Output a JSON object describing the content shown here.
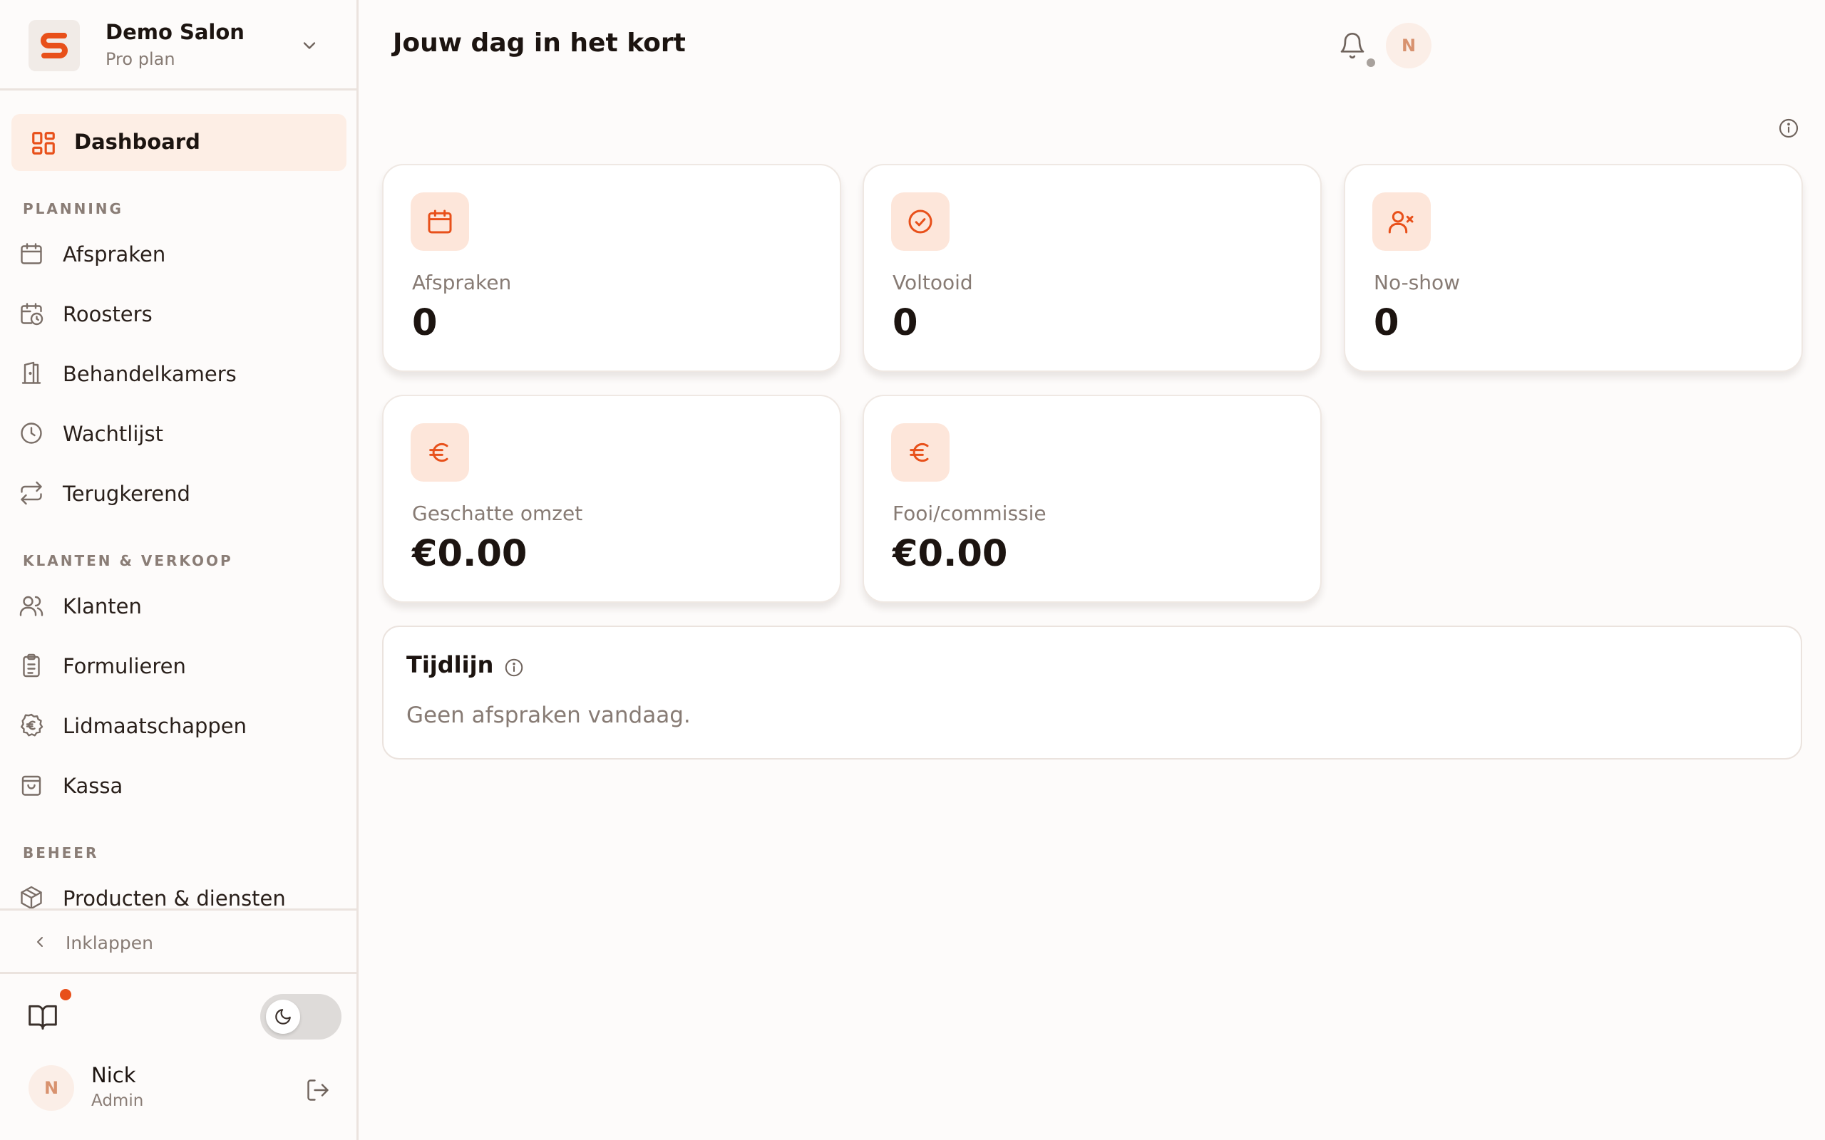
{
  "brand": {
    "name": "Demo Salon",
    "plan": "Pro plan"
  },
  "nav": {
    "active_label": "Dashboard",
    "sections": [
      {
        "label": "PLANNING",
        "items": [
          "Afspraken",
          "Roosters",
          "Behandelkamers",
          "Wachtlijst",
          "Terugkerend"
        ]
      },
      {
        "label": "KLANTEN & VERKOOP",
        "items": [
          "Klanten",
          "Formulieren",
          "Lidmaatschappen",
          "Kassa"
        ]
      },
      {
        "label": "BEHEER",
        "items": [
          "Producten & diensten"
        ]
      }
    ],
    "collapse_label": "Inklappen"
  },
  "user": {
    "initial": "N",
    "name": "Nick",
    "role": "Admin"
  },
  "header": {
    "title": "Jouw dag in het kort",
    "avatar_initial": "N"
  },
  "stats": [
    {
      "label": "Afspraken",
      "value": "0",
      "icon": "calendar-icon"
    },
    {
      "label": "Voltooid",
      "value": "0",
      "icon": "check-circle-icon"
    },
    {
      "label": "No-show",
      "value": "0",
      "icon": "user-x-icon"
    },
    {
      "label": "Geschatte omzet",
      "value": "€0.00",
      "icon": "euro-icon"
    },
    {
      "label": "Fooi/commissie",
      "value": "€0.00",
      "icon": "euro-icon"
    }
  ],
  "timeline": {
    "title": "Tijdlijn",
    "empty_text": "Geen afspraken vandaag."
  },
  "colors": {
    "accent": "#e8501a",
    "accent_soft": "#fde6da",
    "active_bg": "#fdeee5"
  }
}
